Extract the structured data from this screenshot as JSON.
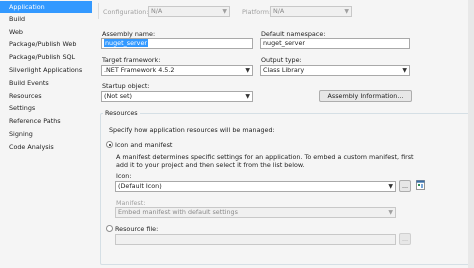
{
  "sidebar": {
    "items": [
      {
        "label": "Application",
        "active": true
      },
      {
        "label": "Build"
      },
      {
        "label": "Web"
      },
      {
        "label": "Package/Publish Web"
      },
      {
        "label": "Package/Publish SQL"
      },
      {
        "label": "Silverlight Applications"
      },
      {
        "label": "Build Events"
      },
      {
        "label": "Resources"
      },
      {
        "label": "Settings"
      },
      {
        "label": "Reference Paths"
      },
      {
        "label": "Signing"
      },
      {
        "label": "Code Analysis"
      }
    ]
  },
  "toolbar": {
    "configuration_label": "Configuration:",
    "configuration_value": "N/A",
    "platform_label": "Platform:",
    "platform_value": "N/A"
  },
  "app": {
    "assembly_name_label": "Assembly name:",
    "assembly_name_value": "nuget_server",
    "default_namespace_label": "Default namespace:",
    "default_namespace_value": "nuget_server",
    "target_framework_label": "Target framework:",
    "target_framework_value": ".NET Framework 4.5.2",
    "output_type_label": "Output type:",
    "output_type_value": "Class Library",
    "startup_object_label": "Startup object:",
    "startup_object_value": "(Not set)",
    "assembly_info_button": "Assembly Information..."
  },
  "resources": {
    "legend": "Resources",
    "intro": "Specify how application resources will be managed:",
    "icon_manifest_label": "Icon and manifest",
    "icon_manifest_checked": true,
    "manifest_desc": "A manifest determines specific settings for an application. To embed a custom manifest, first add it to your project and then select it from the list below.",
    "icon_label": "Icon:",
    "icon_value": "(Default Icon)",
    "browse_label": "...",
    "manifest_label": "Manifest:",
    "manifest_value": "Embed manifest with default settings",
    "resource_file_label": "Resource file:",
    "resource_file_checked": false,
    "resource_file_value": ""
  }
}
